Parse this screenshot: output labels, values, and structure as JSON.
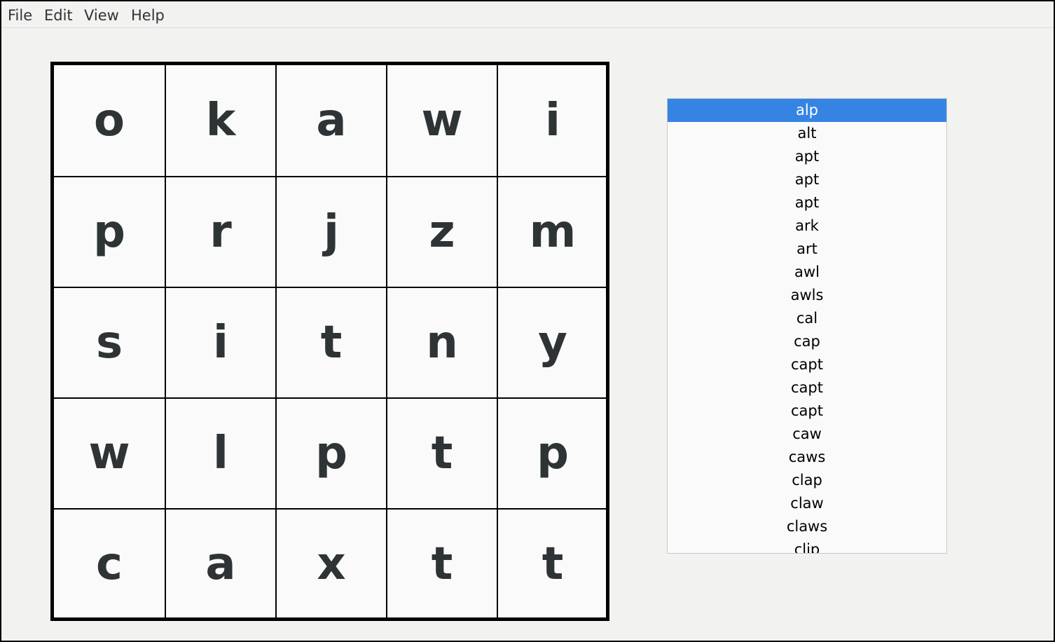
{
  "menu": {
    "file": "File",
    "edit": "Edit",
    "view": "View",
    "help": "Help"
  },
  "board": {
    "rows": [
      [
        "o",
        "k",
        "a",
        "w",
        "i"
      ],
      [
        "p",
        "r",
        "j",
        "z",
        "m"
      ],
      [
        "s",
        "i",
        "t",
        "n",
        "y"
      ],
      [
        "w",
        "l",
        "p",
        "t",
        "p"
      ],
      [
        "c",
        "a",
        "x",
        "t",
        "t"
      ]
    ]
  },
  "word_list": {
    "selected_index": 0,
    "words": [
      "alp",
      "alt",
      "apt",
      "apt",
      "apt",
      "ark",
      "art",
      "awl",
      "awls",
      "cal",
      "cap",
      "capt",
      "capt",
      "capt",
      "caw",
      "caws",
      "clap",
      "claw",
      "claws",
      "clip"
    ]
  },
  "colors": {
    "selection": "#3584e4",
    "letter": "#2e3436"
  }
}
